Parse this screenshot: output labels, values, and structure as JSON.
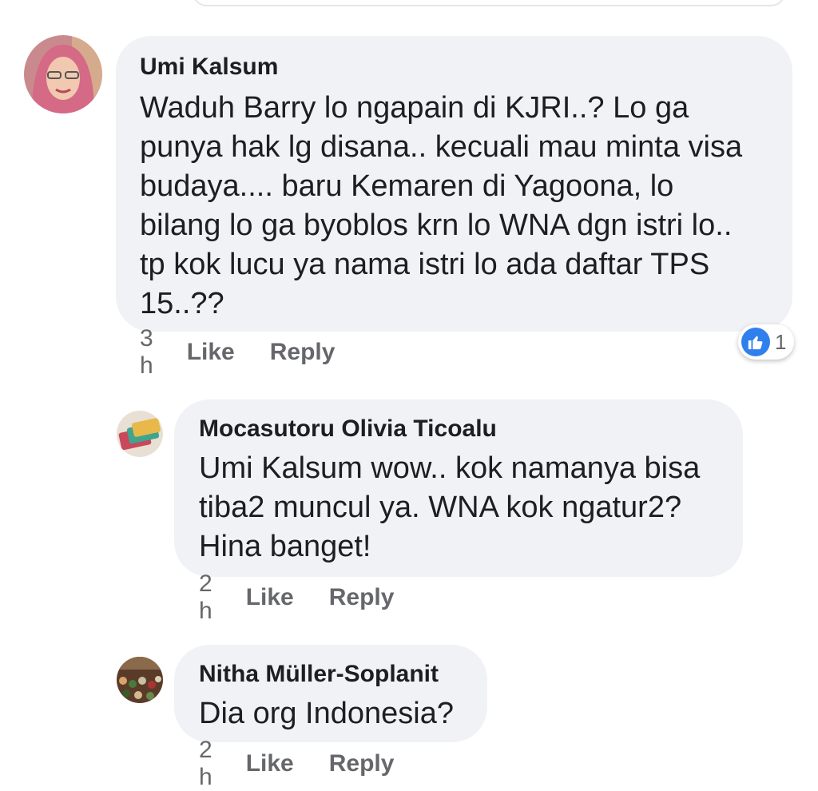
{
  "colors": {
    "bubble": "#f0f2f5",
    "meta_text": "#65676b",
    "reaction_blue": "#2f80ed"
  },
  "comments": [
    {
      "author": "Umi Kalsum",
      "lines": [
        "Waduh Barry lo ngapain di KJRI..? Lo ga",
        "punya hak lg disana.. kecuali mau minta visa",
        "budaya.... baru Kemaren di Yagoona, lo",
        "bilang lo ga byoblos krn lo WNA dgn istri lo..",
        "tp kok lucu ya nama istri lo ada daftar TPS",
        "15..??"
      ],
      "time": "3 h",
      "like_label": "Like",
      "reply_label": "Reply",
      "reaction_icon": "thumbs-up-icon",
      "reaction_count": "1"
    },
    {
      "author": "Mocasutoru Olivia Ticoalu",
      "lines": [
        "Umi Kalsum wow.. kok namanya bisa",
        "tiba2 muncul ya. WNA kok ngatur2?",
        "Hina banget!"
      ],
      "time": "2 h",
      "like_label": "Like",
      "reply_label": "Reply"
    },
    {
      "author": "Nitha Müller-Soplanit",
      "lines": [
        "Dia org Indonesia?"
      ],
      "time": "2 h",
      "like_label": "Like",
      "reply_label": "Reply"
    }
  ]
}
